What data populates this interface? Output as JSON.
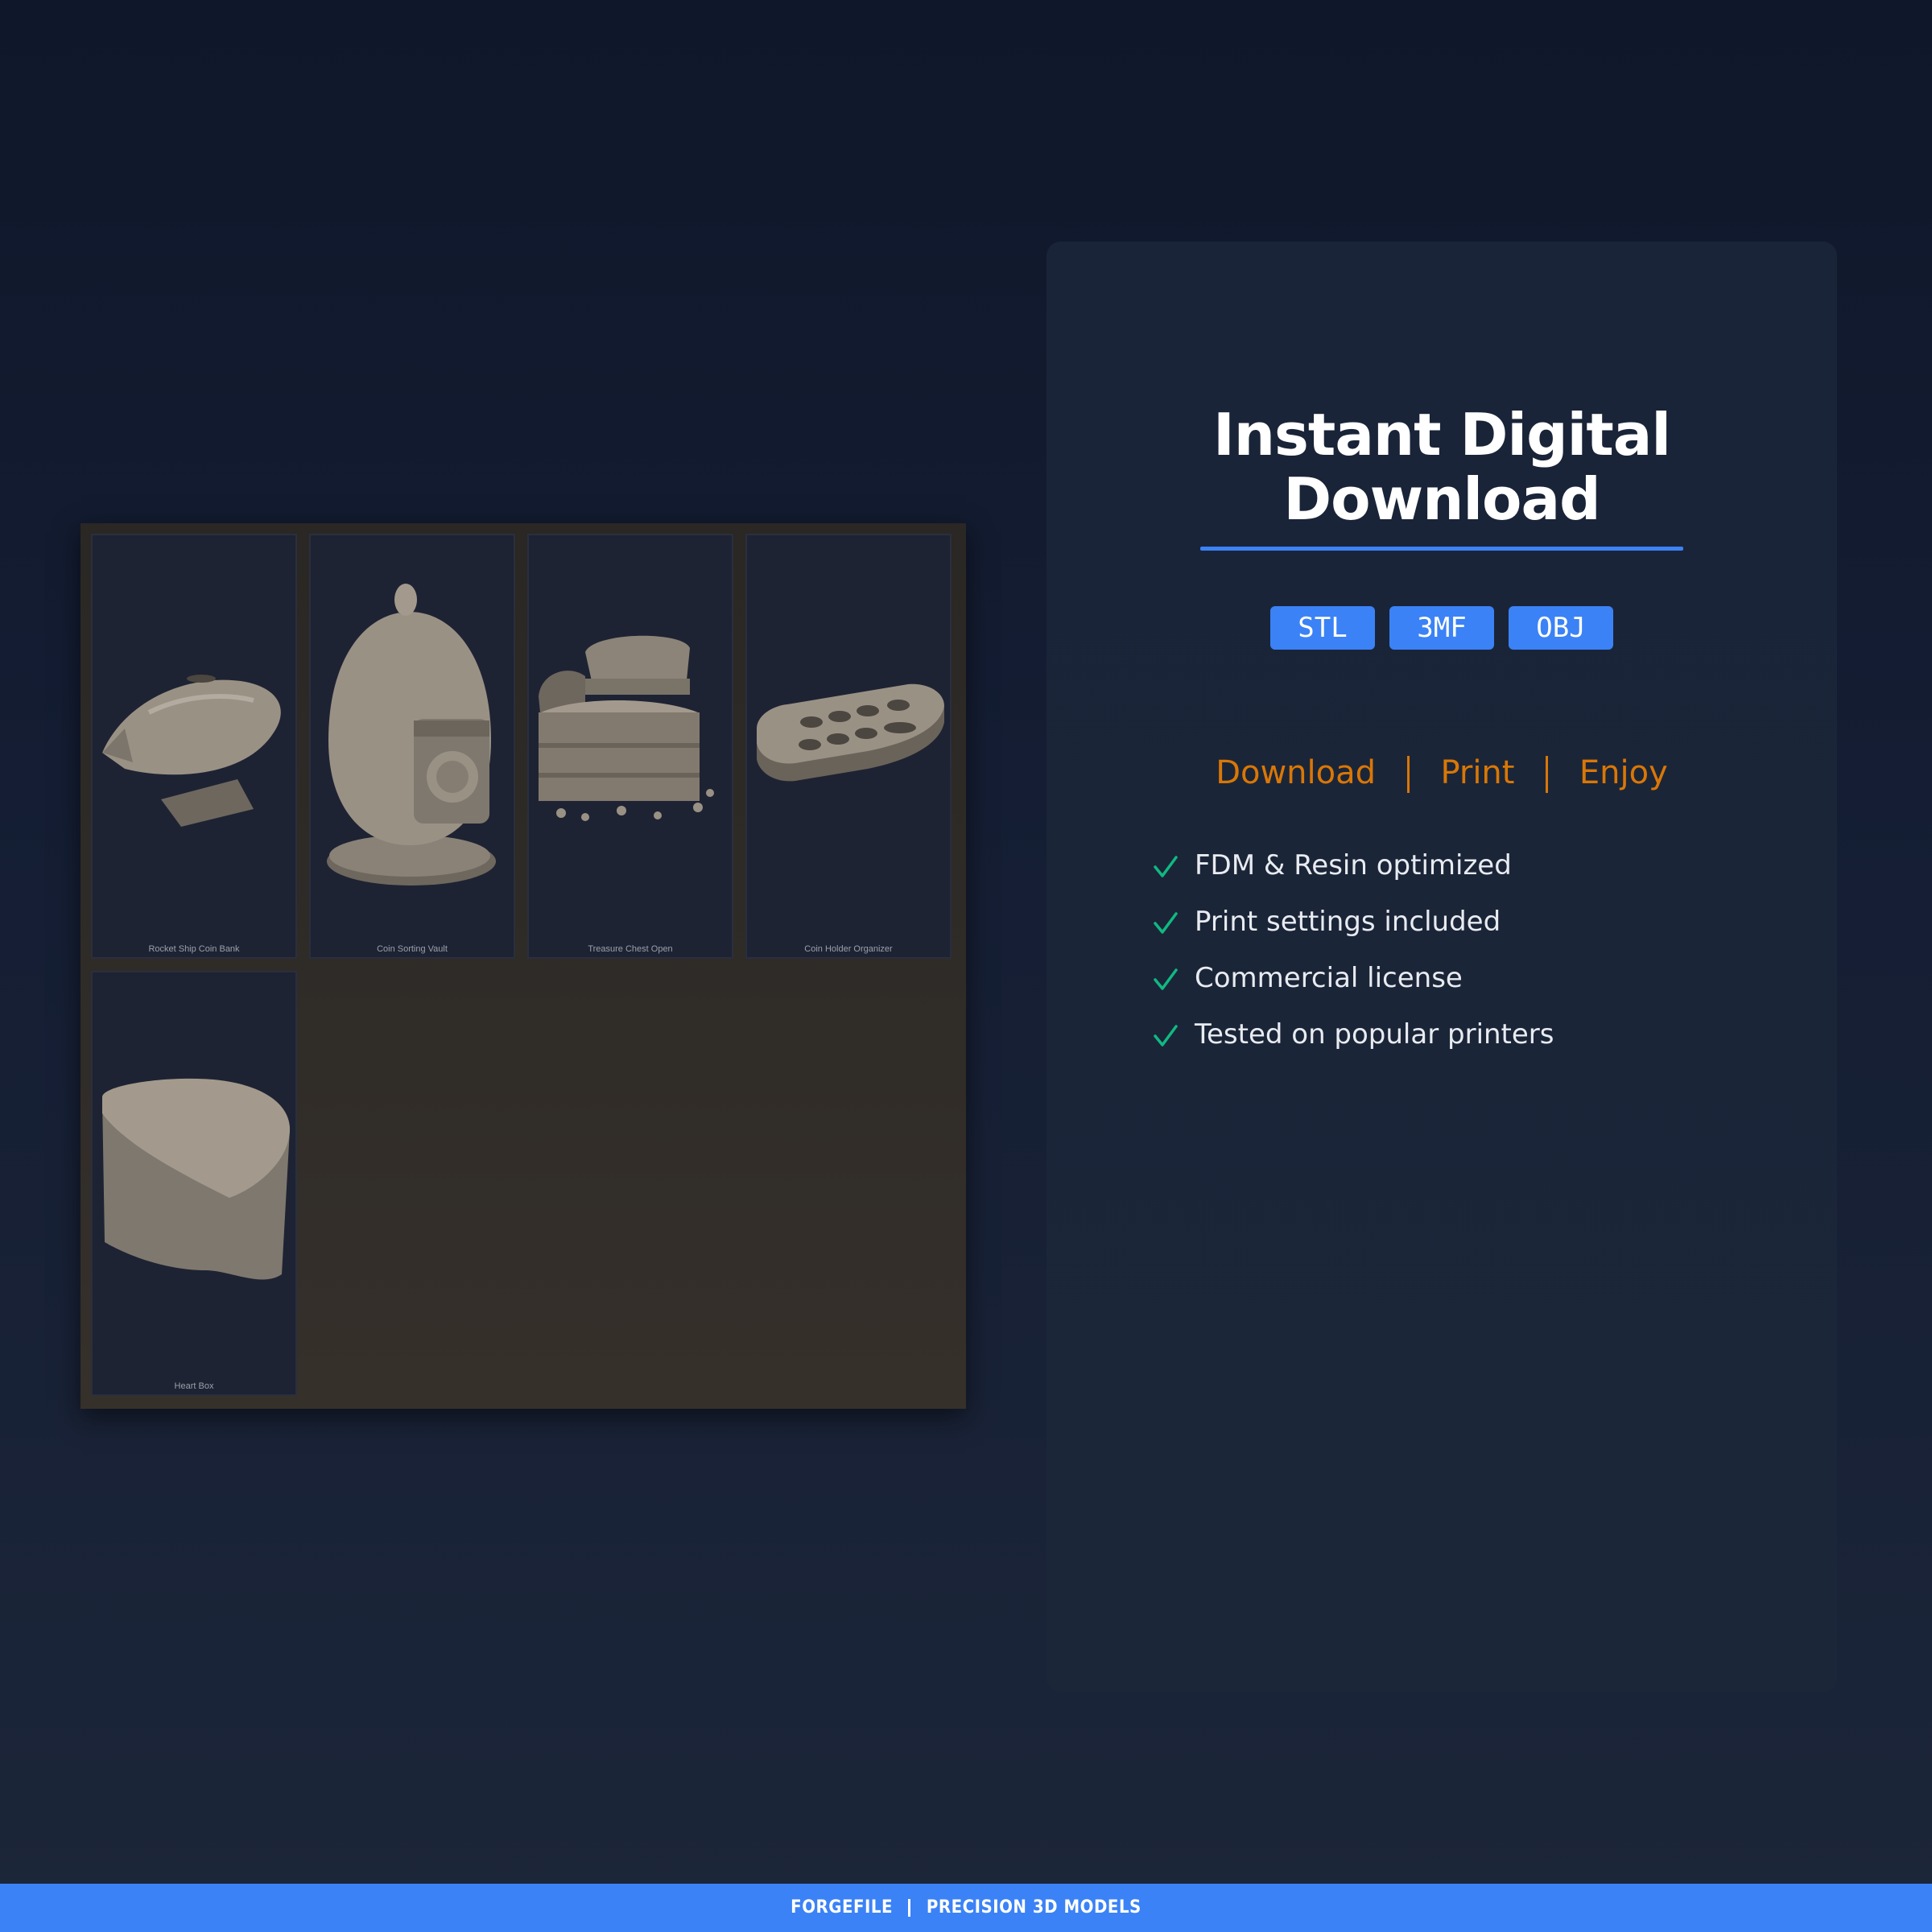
{
  "products": [
    {
      "label": "Rocket Ship Coin Bank",
      "icon": "rocket-coin-bank-render"
    },
    {
      "label": "Coin Sorting Vault",
      "icon": "coin-vault-render"
    },
    {
      "label": "Treasure Chest Open",
      "icon": "treasure-chest-render"
    },
    {
      "label": "Coin Holder Organizer",
      "icon": "coin-organizer-render"
    },
    {
      "label": "Heart Box",
      "icon": "heart-box-render"
    }
  ],
  "info": {
    "title_line1": "Instant Digital",
    "title_line2": "Download",
    "formats": [
      "STL",
      "3MF",
      "OBJ"
    ],
    "steps": [
      "Download",
      "Print",
      "Enjoy"
    ],
    "features": [
      "FDM & Resin optimized",
      "Print settings included",
      "Commercial license",
      "Tested on popular printers"
    ]
  },
  "footer": {
    "brand": "FORGEFILE",
    "tagline": "PRECISION 3D MODELS"
  },
  "colors": {
    "accent": "#3b82f6",
    "steps": "#d97706",
    "check": "#10b981"
  }
}
